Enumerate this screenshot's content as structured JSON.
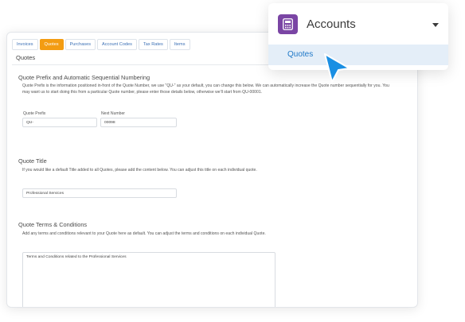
{
  "tabs": [
    {
      "label": "Invoices"
    },
    {
      "label": "Quotes"
    },
    {
      "label": "Purchases"
    },
    {
      "label": "Account Codes"
    },
    {
      "label": "Tax Rates"
    },
    {
      "label": "Items"
    }
  ],
  "card": {
    "title": "Quotes"
  },
  "prefix_section": {
    "title": "Quote Prefix and Automatic Sequential Numbering",
    "desc": "Quote Prefix is the information positioned in-front of the Quote Number, we use \"QU-\" as your default, you can change this below. We can automatically increase the Quote number sequentially for you. You may want us to start doing this from a particular Quote number, please enter those details below, otherwise we'll start from QU-00001.",
    "prefix_label": "Quote Prefix",
    "prefix_value": "QU-",
    "next_label": "Next Number",
    "next_value": "00098"
  },
  "title_section": {
    "title": "Quote Title",
    "desc": "If you would like a default Title added to all Quotes, please add the content below. You can adjust this title on each individual quote.",
    "value": "Professional Services"
  },
  "terms_section": {
    "title": "Quote Terms & Conditions",
    "desc": "Add any terms and conditions relevant to your Quote here as default. You can adjust the terms and conditions on each individual Quote.",
    "value": "Terms and Conditions related to the Professional Services"
  },
  "popup": {
    "title": "Accounts",
    "icon": "calculator-icon",
    "item": "Quotes",
    "accent": "#7a45a4",
    "highlight": "#e4eef8",
    "cursor_color": "#1a8fe3"
  }
}
